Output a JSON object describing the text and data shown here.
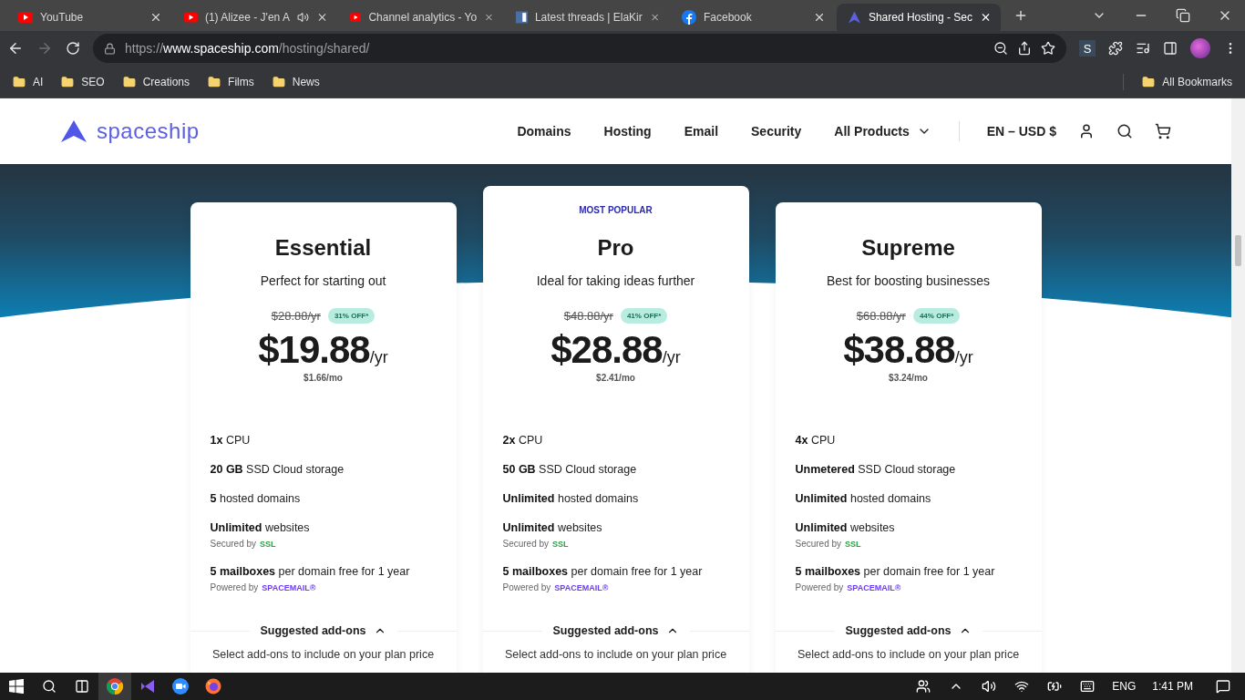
{
  "browser": {
    "tabs": [
      {
        "title": "YouTube",
        "kind": "youtube",
        "selected": false,
        "audio": false
      },
      {
        "title": "(1) Alizee - J'en A",
        "kind": "youtube",
        "selected": false,
        "audio": true
      },
      {
        "title": "Channel analytics - Yo",
        "kind": "youtube",
        "selected": false,
        "audio": false
      },
      {
        "title": "Latest threads | ElaKir",
        "kind": "forum",
        "selected": false,
        "audio": false
      },
      {
        "title": "Facebook",
        "kind": "facebook",
        "selected": false,
        "audio": false
      },
      {
        "title": "Shared Hosting - Sec",
        "kind": "spaceship",
        "selected": true,
        "audio": false
      }
    ],
    "forward_disabled": true,
    "address": {
      "scheme": "https://",
      "host": "www.spaceship.com",
      "path": "/hosting/shared/"
    },
    "extension_letter": "S",
    "bookmarks": [
      "AI",
      "SEO",
      "Creations",
      "Films",
      "News"
    ],
    "all_bookmarks": "All Bookmarks"
  },
  "site": {
    "logo": "spaceship",
    "nav": [
      {
        "label": "Domains",
        "dropdown": false
      },
      {
        "label": "Hosting",
        "dropdown": false
      },
      {
        "label": "Email",
        "dropdown": false
      },
      {
        "label": "Security",
        "dropdown": false
      },
      {
        "label": "All Products",
        "dropdown": true
      }
    ],
    "locale": "EN – USD $"
  },
  "plans": [
    {
      "popular": false,
      "name": "Essential",
      "tagline": "Perfect for starting out",
      "old_price": "$28.88/yr",
      "discount": "31% OFF*",
      "price": "$19.88",
      "unit": "/yr",
      "monthly": "$1.66/mo",
      "features": [
        {
          "text": "**1x** CPU"
        },
        {
          "text": "**20 GB** SSD Cloud storage"
        },
        {
          "text": "**5** hosted domains"
        },
        {
          "text": "**Unlimited** websites",
          "note": "Secured by",
          "brand": "SSL",
          "kind": "ssl"
        },
        {
          "text": "**5 mailboxes** per domain free for 1 year",
          "note": "Powered by",
          "brand": "SPACEMAIL®",
          "kind": "mail"
        }
      ],
      "addons_label": "Suggested add-ons",
      "addons_text": "Select add-ons to include on your plan price"
    },
    {
      "popular": true,
      "badge": "MOST POPULAR",
      "name": "Pro",
      "tagline": "Ideal for taking ideas further",
      "old_price": "$48.88/yr",
      "discount": "41% OFF*",
      "price": "$28.88",
      "unit": "/yr",
      "monthly": "$2.41/mo",
      "features": [
        {
          "text": "**2x** CPU"
        },
        {
          "text": "**50 GB** SSD Cloud storage"
        },
        {
          "text": "**Unlimited** hosted domains"
        },
        {
          "text": "**Unlimited** websites",
          "note": "Secured by",
          "brand": "SSL",
          "kind": "ssl"
        },
        {
          "text": "**5 mailboxes** per domain free for 1 year",
          "note": "Powered by",
          "brand": "SPACEMAIL®",
          "kind": "mail"
        }
      ],
      "addons_label": "Suggested add-ons",
      "addons_text": "Select add-ons to include on your plan price"
    },
    {
      "popular": false,
      "name": "Supreme",
      "tagline": "Best for boosting businesses",
      "old_price": "$68.88/yr",
      "discount": "44% OFF*",
      "price": "$38.88",
      "unit": "/yr",
      "monthly": "$3.24/mo",
      "features": [
        {
          "text": "**4x** CPU"
        },
        {
          "text": "**Unmetered** SSD Cloud storage"
        },
        {
          "text": "**Unlimited** hosted domains"
        },
        {
          "text": "**Unlimited** websites",
          "note": "Secured by",
          "brand": "SSL",
          "kind": "ssl"
        },
        {
          "text": "**5 mailboxes** per domain free for 1 year",
          "note": "Powered by",
          "brand": "SPACEMAIL®",
          "kind": "mail"
        }
      ],
      "addons_label": "Suggested add-ons",
      "addons_text": "Select add-ons to include on your plan price"
    }
  ],
  "taskbar": {
    "language": "ENG",
    "time": "1:41 PM"
  }
}
